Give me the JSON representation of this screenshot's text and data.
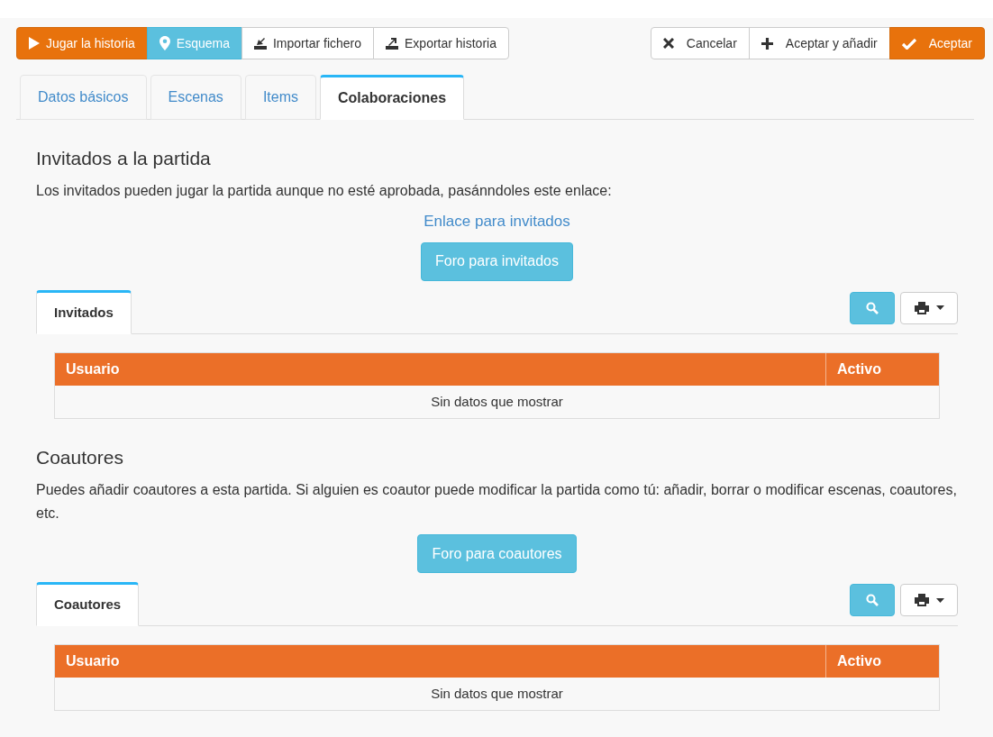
{
  "toolbar": {
    "left": [
      {
        "label": "Jugar la historia",
        "kind": "play"
      },
      {
        "label": "Esquema",
        "kind": "schema"
      },
      {
        "label": "Importar fichero",
        "kind": "import"
      },
      {
        "label": "Exportar historia",
        "kind": "export"
      }
    ],
    "right": [
      {
        "label": "Cancelar",
        "kind": "cancel"
      },
      {
        "label": "Aceptar y añadir",
        "kind": "add"
      },
      {
        "label": "Aceptar",
        "kind": "accept"
      }
    ]
  },
  "tabs": [
    {
      "label": "Datos básicos",
      "selected": false
    },
    {
      "label": "Escenas",
      "selected": false
    },
    {
      "label": "Items",
      "selected": false
    },
    {
      "label": "Colaboraciones",
      "selected": true
    }
  ],
  "sections": [
    {
      "title": "Invitados a la partida",
      "text": "Los invitados pueden jugar la partida aunque no esté aprobada, pasánndoles este enlace:",
      "link": "Enlace para invitados",
      "button": "Foro para invitados",
      "subtab": {
        "label": "Invitados",
        "selected": true
      },
      "table": {
        "columns": [
          "Usuario",
          "Activo"
        ],
        "empty": "Sin datos que mostrar"
      }
    },
    {
      "title": "Coautores",
      "text": "Puedes añadir coautores a esta partida. Si alguien es coautor puede modificar la partida como tú: añadir, borrar o modificar escenas, coautores, etc.",
      "button": "Foro para coautores",
      "subtab": {
        "label": "Coautores",
        "selected": true
      },
      "table": {
        "columns": [
          "Usuario",
          "Activo"
        ],
        "empty": "Sin datos que mostrar"
      }
    }
  ]
}
